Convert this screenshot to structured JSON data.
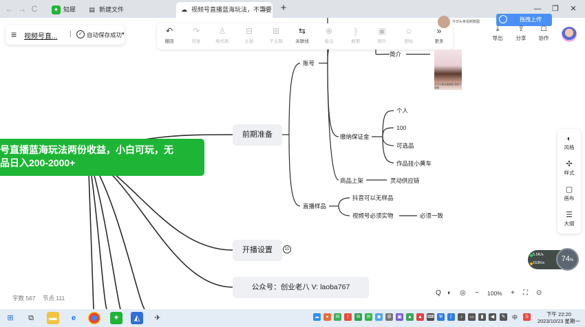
{
  "browser": {
    "nav": {
      "back": "←",
      "forward": "→",
      "reload": "C"
    },
    "tabs": [
      {
        "label": "知犀",
        "active": false
      },
      {
        "label": "新建文件",
        "active": false
      },
      {
        "label": "视频号直播蓝海玩法，不需要",
        "active": true
      }
    ],
    "new_tab": "+",
    "window_controls": {
      "minimize": "—",
      "restore": "❐",
      "close": "✕"
    }
  },
  "doc": {
    "menu_icon": "≡",
    "title": "视频号直...",
    "separator": "|",
    "save_status": "自动保存成功",
    "caret": "▾"
  },
  "toolbar": {
    "items": [
      {
        "label": "撤回",
        "icon": "undo-icon",
        "glyph": "↶",
        "enabled": true
      },
      {
        "label": "恢复",
        "icon": "redo-icon",
        "glyph": "↷",
        "enabled": false
      },
      {
        "label": "格式刷",
        "icon": "format-brush-icon",
        "glyph": "♙",
        "enabled": false
      },
      {
        "label": "主题",
        "icon": "topic-icon",
        "glyph": "⊟",
        "enabled": false
      },
      {
        "label": "子主题",
        "icon": "subtopic-icon",
        "glyph": "⊞",
        "enabled": false
      },
      {
        "label": "关联线",
        "icon": "relation-line-icon",
        "glyph": "⇆",
        "enabled": true
      },
      {
        "label": "备注",
        "icon": "note-icon",
        "glyph": "⊕",
        "enabled": false
      },
      {
        "label": "概要",
        "icon": "summary-icon",
        "glyph": "}",
        "enabled": false
      },
      {
        "label": "图片",
        "icon": "image-icon",
        "glyph": "▣",
        "enabled": false
      },
      {
        "label": "图标",
        "icon": "emoji-icon",
        "glyph": "☺",
        "enabled": false
      },
      {
        "label": "更多",
        "icon": "more-icon",
        "glyph": "»",
        "enabled": true
      }
    ]
  },
  "top_right": {
    "upload_label": "拖拽上传",
    "actions": [
      {
        "label": "导出",
        "icon": "export-icon",
        "glyph": "⤓"
      },
      {
        "label": "分享",
        "icon": "share-icon",
        "glyph": "⇪"
      },
      {
        "label": "协作",
        "icon": "collaborate-icon",
        "glyph": "☖"
      }
    ]
  },
  "side_panel": [
    {
      "label": "风格",
      "icon": "palette-icon",
      "glyph": "◐"
    },
    {
      "label": "样式",
      "icon": "style-icon",
      "glyph": "✣"
    },
    {
      "label": "画布",
      "icon": "canvas-icon",
      "glyph": "▢"
    },
    {
      "label": "大纲",
      "icon": "outline-icon",
      "glyph": "☰"
    }
  ],
  "mindmap": {
    "root": "号直播蓝海玩法两份收益，小白可玩，无 品日入200-2000+",
    "root_line1": "号直播蓝海玩法两份收益，小白可玩，无",
    "root_line2": "品日入200-2000+",
    "branches": {
      "prep": "前期准备",
      "start": "开播设置",
      "start_badge": "11",
      "gzh": "公众号：创业老八   V:   laoba767"
    },
    "prep_children": {
      "account": "账号",
      "intro": "简介",
      "deposit": "缴纳保证金",
      "deposit_items": [
        "个人",
        "100",
        "可选品",
        "作品挂小黄车"
      ],
      "listing": "商品上架",
      "supply": "灵动供应链",
      "sample": "直播样品",
      "sample_items": [
        "抖音可以无样品",
        "视频号必须实物"
      ],
      "must_match": "必须一致"
    },
    "thumb_small_text": "今日头条视频截图",
    "thumb_caption": "今日头条视频截图 视频下载器"
  },
  "footer": {
    "word_count": "字数 567",
    "node_count": "节点 111"
  },
  "zoom": {
    "search": "Q",
    "theme": "◐",
    "locate": "◎",
    "minus": "−",
    "level": "100%",
    "plus": "+",
    "fit": "⛶",
    "more": "⊙"
  },
  "network": {
    "up": "5.5K/s",
    "down": "153K/s",
    "percent": "74",
    "percent_unit": "%"
  },
  "taskbar": {
    "ime": "中",
    "clock_time": "下午 22:20",
    "clock_date": "2023/10/23 星期一"
  },
  "colors": {
    "root_green": "#1eb536",
    "upload_blue": "#4a90f5",
    "tab_bar": "#dfe3e8",
    "taskbar": "#e4ecf6"
  }
}
